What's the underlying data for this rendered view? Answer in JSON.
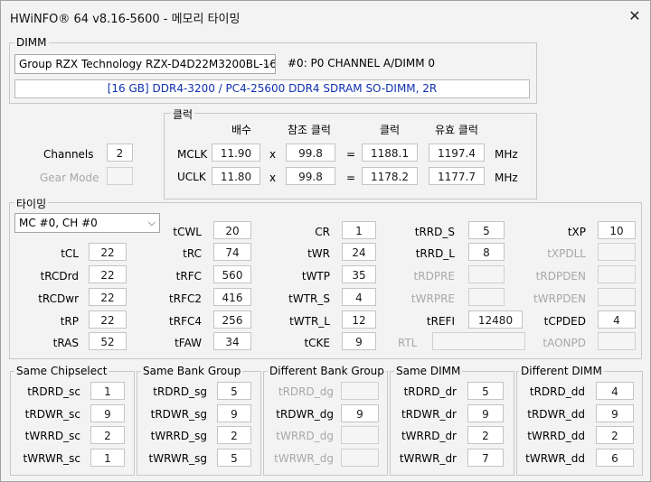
{
  "window": {
    "title": "HWiNFO® 64 v8.16-5600 - 메모리 타이밍",
    "close": "✕"
  },
  "dimm": {
    "group_label": "DIMM",
    "module_select": "Group RZX Technology RZX-D4D22M3200BL-16",
    "channel": "#0: P0 CHANNEL A/DIMM 0",
    "description": "[16 GB] DDR4-3200 / PC4-25600 DDR4 SDRAM SO-DIMM, 2R"
  },
  "clock": {
    "group_label": "클럭",
    "headers": {
      "multiplier": "배수",
      "ref": "참조 클럭",
      "clock": "클럭",
      "effective": "유효 클럭"
    },
    "rows": [
      {
        "name": "MCLK",
        "mult": "11.90",
        "x": "x",
        "ref": "99.8",
        "eq": "=",
        "clock": "1188.1",
        "eff": "1197.4",
        "unit": "MHz"
      },
      {
        "name": "UCLK",
        "mult": "11.80",
        "x": "x",
        "ref": "99.8",
        "eq": "=",
        "clock": "1178.2",
        "eff": "1177.7",
        "unit": "MHz"
      }
    ]
  },
  "channels": {
    "label": "Channels",
    "value": "2",
    "gear_label": "Gear Mode",
    "gear_value": ""
  },
  "timings": {
    "group_label": "타이밍",
    "select": "MC #0, CH #0",
    "tCWL": "20",
    "CR": "1",
    "tRRD_S": "5",
    "tXP": "10",
    "tCL": "22",
    "tRC": "74",
    "tWR": "24",
    "tRRD_L": "8",
    "tXPDLL": "",
    "tRCDrd": "22",
    "tRFC": "560",
    "tWTP": "35",
    "tRDPRE": "",
    "tRDPDEN": "",
    "tRCDwr": "22",
    "tRFC2": "416",
    "tWTR_S": "4",
    "tWRPRE": "",
    "tWRPDEN": "",
    "tRP": "22",
    "tRFC4": "256",
    "tWTR_L": "12",
    "tREFI": "12480",
    "tCPDED": "4",
    "tRAS": "52",
    "tFAW": "34",
    "tCKE": "9",
    "RTL": "",
    "tAONPD": ""
  },
  "groups": [
    {
      "title": "Same Chipselect",
      "rows": [
        {
          "label": "tRDRD_sc",
          "value": "1",
          "disabled": false
        },
        {
          "label": "tRDWR_sc",
          "value": "9",
          "disabled": false
        },
        {
          "label": "tWRRD_sc",
          "value": "2",
          "disabled": false
        },
        {
          "label": "tWRWR_sc",
          "value": "1",
          "disabled": false
        }
      ]
    },
    {
      "title": "Same Bank Group",
      "rows": [
        {
          "label": "tRDRD_sg",
          "value": "5",
          "disabled": false
        },
        {
          "label": "tRDWR_sg",
          "value": "9",
          "disabled": false
        },
        {
          "label": "tWRRD_sg",
          "value": "2",
          "disabled": false
        },
        {
          "label": "tWRWR_sg",
          "value": "5",
          "disabled": false
        }
      ]
    },
    {
      "title": "Different Bank Group",
      "rows": [
        {
          "label": "tRDRD_dg",
          "value": "",
          "disabled": true
        },
        {
          "label": "tRDWR_dg",
          "value": "9",
          "disabled": false
        },
        {
          "label": "tWRRD_dg",
          "value": "",
          "disabled": true
        },
        {
          "label": "tWRWR_dg",
          "value": "",
          "disabled": true
        }
      ]
    },
    {
      "title": "Same DIMM",
      "rows": [
        {
          "label": "tRDRD_dr",
          "value": "5",
          "disabled": false
        },
        {
          "label": "tRDWR_dr",
          "value": "9",
          "disabled": false
        },
        {
          "label": "tWRRD_dr",
          "value": "2",
          "disabled": false
        },
        {
          "label": "tWRWR_dr",
          "value": "7",
          "disabled": false
        }
      ]
    },
    {
      "title": "Different DIMM",
      "rows": [
        {
          "label": "tRDRD_dd",
          "value": "4",
          "disabled": false
        },
        {
          "label": "tRDWR_dd",
          "value": "9",
          "disabled": false
        },
        {
          "label": "tWRRD_dd",
          "value": "2",
          "disabled": false
        },
        {
          "label": "tWRWR_dd",
          "value": "6",
          "disabled": false
        }
      ]
    }
  ]
}
